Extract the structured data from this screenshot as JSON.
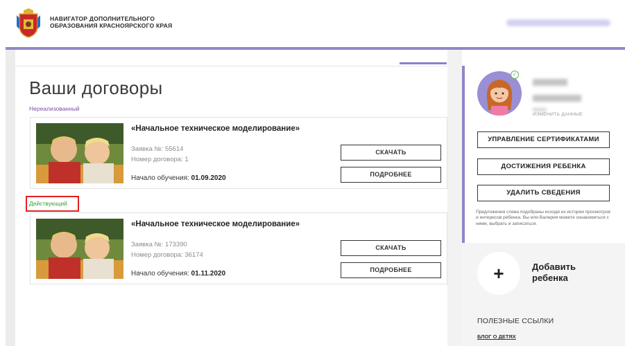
{
  "header": {
    "brand_line1": "НАВИГАТОР ДОПОЛНИТЕЛЬНОГО",
    "brand_line2": "ОБРАЗОВАНИЯ КРАСНОЯРСКОГО КРАЯ"
  },
  "main": {
    "title": "Ваши договоры",
    "groups": [
      {
        "status": "Нереализованный",
        "card": {
          "title": "«Начальное техническое моделирование»",
          "application": "Заявка №: 55614",
          "contract": "Номер договора: 1",
          "start_label": "Начало обучения: ",
          "start_date": "01.09.2020",
          "download_label": "СКАЧАТЬ",
          "details_label": "ПОДРОБНЕЕ"
        }
      },
      {
        "status": "Действующий",
        "card": {
          "title": "«Начальное техническое моделирование»",
          "application": "Заявка №: 173390",
          "contract": "Номер договора: 36174",
          "start_label": "Начало обучения: ",
          "start_date": "01.11.2020",
          "download_label": "СКАЧАТЬ",
          "details_label": "ПОДРОБНЕЕ"
        }
      }
    ]
  },
  "sidebar": {
    "edit_link": "ИЗМЕНИТЬ ДАННЫЕ",
    "buttons": {
      "certificates": "УПРАВЛЕНИЕ СЕРТИФИКАТАМИ",
      "achievements": "ДОСТИЖЕНИЯ РЕБЕНКА",
      "delete": "УДАЛИТЬ СВЕДЕНИЯ"
    },
    "note": "Предложения слева подобраны исходя из истории просмотров и интересов ребенка. Вы или Валерия можете ознакомиться с ними, выбрать и записаться.",
    "add_child_line1": "Добавить",
    "add_child_line2": "ребенка",
    "add_icon_glyph": "+",
    "useful_links_title": "ПОЛЕЗНЫЕ ССЫЛКИ",
    "useful_links": [
      "БЛОГ О ДЕТЯХ"
    ]
  },
  "colors": {
    "accent_purple": "#9088c9",
    "status_unrealized": "#7a4ea0",
    "status_active": "#3a9a3a",
    "highlight_red": "#e02020"
  }
}
